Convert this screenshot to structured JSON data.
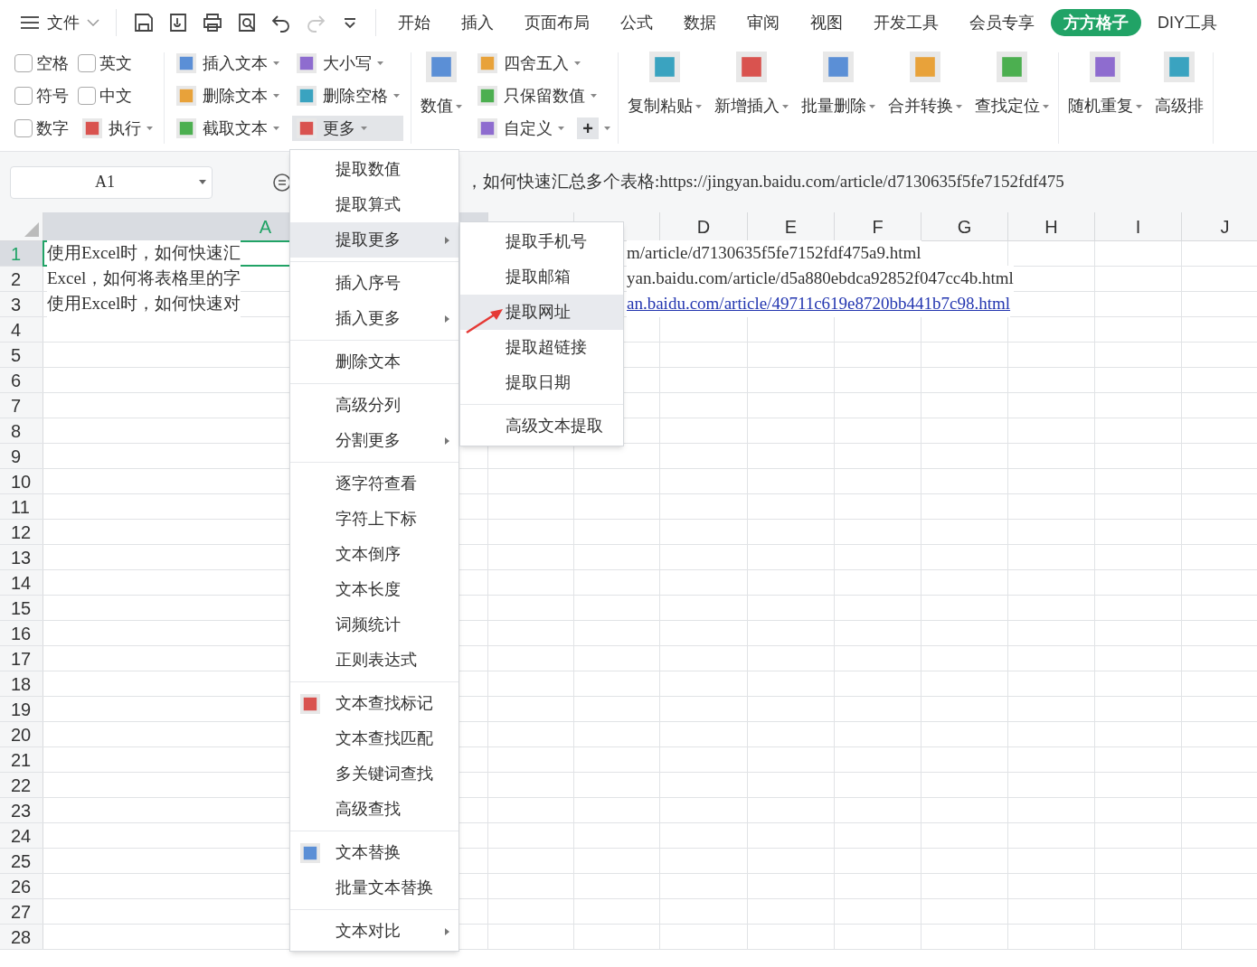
{
  "top_bar": {
    "file_menu": "文件",
    "tabs": [
      {
        "label": "开始",
        "selected": false
      },
      {
        "label": "插入",
        "selected": false
      },
      {
        "label": "页面布局",
        "selected": false
      },
      {
        "label": "公式",
        "selected": false
      },
      {
        "label": "数据",
        "selected": false
      },
      {
        "label": "审阅",
        "selected": false
      },
      {
        "label": "视图",
        "selected": false
      },
      {
        "label": "开发工具",
        "selected": false
      },
      {
        "label": "会员专享",
        "selected": false
      },
      {
        "label": "方方格子",
        "selected": true
      },
      {
        "label": "DIY工具",
        "selected": false
      }
    ]
  },
  "ribbon": [
    {
      "columns": [
        [
          {
            "kind": "checkbox",
            "label": "空格",
            "checked": false
          },
          {
            "kind": "checkbox",
            "label": "符号",
            "checked": false
          },
          {
            "kind": "checkbox",
            "label": "数字",
            "checked": false
          }
        ],
        [
          {
            "kind": "checkbox",
            "label": "英文",
            "checked": false
          },
          {
            "kind": "checkbox",
            "label": "中文",
            "checked": false
          },
          {
            "kind": "button",
            "label": "执行",
            "dropdown": true,
            "pressed": false
          }
        ]
      ]
    },
    {
      "columns": [
        [
          {
            "kind": "button",
            "label": "插入文本",
            "dropdown": true,
            "pressed": false
          },
          {
            "kind": "button",
            "label": "删除文本",
            "dropdown": true,
            "pressed": false
          },
          {
            "kind": "button",
            "label": "截取文本",
            "dropdown": true,
            "pressed": false
          }
        ],
        [
          {
            "kind": "button",
            "label": "大小写",
            "dropdown": true,
            "pressed": false
          },
          {
            "kind": "button",
            "label": "删除空格",
            "dropdown": true,
            "pressed": false
          },
          {
            "kind": "button",
            "label": "更多",
            "dropdown": true,
            "pressed": true
          }
        ]
      ]
    },
    {
      "columns": [
        [
          {
            "kind": "large",
            "label": "数值",
            "dropdown": true
          }
        ],
        [
          {
            "kind": "button",
            "label": "四舍五入",
            "dropdown": true,
            "pressed": false
          },
          {
            "kind": "button",
            "label": "只保留数值",
            "dropdown": true,
            "pressed": false
          },
          {
            "kind": "button",
            "label": "自定义",
            "dropdown": true,
            "pressed": false
          }
        ]
      ]
    },
    {
      "columns": [
        [
          {
            "kind": "large",
            "label": "复制粘贴",
            "dropdown": true
          }
        ],
        [
          {
            "kind": "large",
            "label": "新增插入",
            "dropdown": true
          }
        ],
        [
          {
            "kind": "large",
            "label": "批量删除",
            "dropdown": true
          }
        ],
        [
          {
            "kind": "large",
            "label": "合并转换",
            "dropdown": true
          }
        ],
        [
          {
            "kind": "large",
            "label": "查找定位",
            "dropdown": true
          }
        ]
      ]
    },
    {
      "columns": [
        [
          {
            "kind": "large",
            "label": "随机重复",
            "dropdown": true
          }
        ],
        [
          {
            "kind": "large",
            "label": "高级排",
            "dropdown": false
          }
        ]
      ]
    }
  ],
  "plus_button": {
    "label": "+",
    "dropdown": true
  },
  "formula_bar": {
    "cell_name": "A1",
    "content": "，如何快速汇总多个表格:https://jingyan.baidu.com/article/d7130635f5fe7152fdf475"
  },
  "column_headers": [
    {
      "label": "A",
      "selected": true
    },
    {
      "label": "D",
      "selected": false
    },
    {
      "label": "E",
      "selected": false
    },
    {
      "label": "F",
      "selected": false
    },
    {
      "label": "G",
      "selected": false
    },
    {
      "label": "H",
      "selected": false
    },
    {
      "label": "I",
      "selected": false
    },
    {
      "label": "J",
      "selected": false
    }
  ],
  "rows": [
    {
      "header": "1",
      "selected": true,
      "left_text": "使用Excel时，如何快速汇",
      "right": {
        "text": "m/article/d7130635f5fe7152fdf475a9.html",
        "link": false
      }
    },
    {
      "header": "2",
      "selected": false,
      "left_text": "Excel，如何将表格里的字",
      "right": {
        "text": "yan.baidu.com/article/d5a880ebdca92852f047cc4b.html",
        "link": false
      }
    },
    {
      "header": "3",
      "selected": false,
      "left_text": "使用Excel时，如何快速对",
      "right": {
        "text": "an.baidu.com/article/49711c619e8720bb441b7c98.html",
        "link": true
      }
    },
    {
      "header": "4",
      "selected": false
    },
    {
      "header": "5",
      "selected": false
    },
    {
      "header": "6",
      "selected": false
    },
    {
      "header": "7",
      "selected": false
    },
    {
      "header": "8",
      "selected": false
    },
    {
      "header": "9",
      "selected": false
    },
    {
      "header": "10",
      "selected": false
    },
    {
      "header": "11",
      "selected": false
    },
    {
      "header": "12",
      "selected": false
    },
    {
      "header": "13",
      "selected": false
    },
    {
      "header": "14",
      "selected": false
    },
    {
      "header": "15",
      "selected": false
    },
    {
      "header": "16",
      "selected": false
    },
    {
      "header": "17",
      "selected": false
    },
    {
      "header": "18",
      "selected": false
    },
    {
      "header": "19",
      "selected": false
    },
    {
      "header": "20",
      "selected": false
    },
    {
      "header": "21",
      "selected": false
    },
    {
      "header": "22",
      "selected": false
    },
    {
      "header": "23",
      "selected": false
    },
    {
      "header": "24",
      "selected": false
    },
    {
      "header": "25",
      "selected": false
    },
    {
      "header": "26",
      "selected": false
    },
    {
      "header": "27",
      "selected": false
    },
    {
      "header": "28",
      "selected": false
    }
  ],
  "context_menu": [
    {
      "kind": "item",
      "label": "提取数值",
      "selected": false
    },
    {
      "kind": "item",
      "label": "提取算式",
      "selected": false
    },
    {
      "kind": "submenu",
      "label": "提取更多",
      "selected": true
    },
    {
      "kind": "separator"
    },
    {
      "kind": "item",
      "label": "插入序号",
      "selected": false
    },
    {
      "kind": "submenu",
      "label": "插入更多",
      "selected": false
    },
    {
      "kind": "separator"
    },
    {
      "kind": "item",
      "label": "删除文本",
      "selected": false
    },
    {
      "kind": "separator"
    },
    {
      "kind": "item",
      "label": "高级分列",
      "selected": false
    },
    {
      "kind": "submenu",
      "label": "分割更多",
      "selected": false
    },
    {
      "kind": "separator"
    },
    {
      "kind": "item",
      "label": "逐字符查看",
      "selected": false
    },
    {
      "kind": "item",
      "label": "字符上下标",
      "selected": false
    },
    {
      "kind": "item",
      "label": "文本倒序",
      "selected": false
    },
    {
      "kind": "item",
      "label": "文本长度",
      "selected": false
    },
    {
      "kind": "item",
      "label": "词频统计",
      "selected": false
    },
    {
      "kind": "item",
      "label": "正则表达式",
      "selected": false
    },
    {
      "kind": "separator"
    },
    {
      "kind": "icon_item",
      "label": "文本查找标记",
      "selected": false
    },
    {
      "kind": "item",
      "label": "文本查找匹配",
      "selected": false
    },
    {
      "kind": "item",
      "label": "多关键词查找",
      "selected": false
    },
    {
      "kind": "item",
      "label": "高级查找",
      "selected": false
    },
    {
      "kind": "separator"
    },
    {
      "kind": "icon_item",
      "label": "文本替换",
      "selected": false
    },
    {
      "kind": "item",
      "label": "批量文本替换",
      "selected": false
    },
    {
      "kind": "separator"
    },
    {
      "kind": "submenu",
      "label": "文本对比",
      "selected": false
    }
  ],
  "submenu": [
    {
      "kind": "item",
      "label": "提取手机号",
      "selected": false
    },
    {
      "kind": "item",
      "label": "提取邮箱",
      "selected": false
    },
    {
      "kind": "item",
      "label": "提取网址",
      "selected": true
    },
    {
      "kind": "item",
      "label": "提取超链接",
      "selected": false
    },
    {
      "kind": "item",
      "label": "提取日期",
      "selected": false
    },
    {
      "kind": "separator"
    },
    {
      "kind": "item",
      "label": "高级文本提取",
      "selected": false
    }
  ]
}
